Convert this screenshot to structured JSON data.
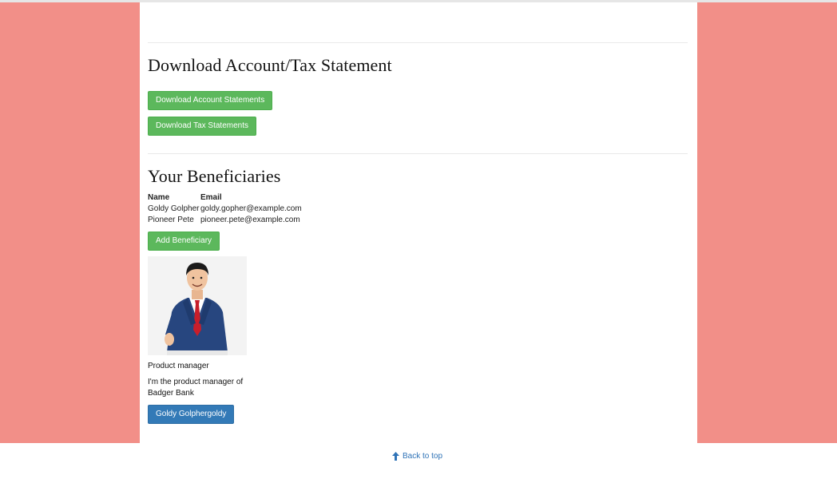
{
  "statements": {
    "heading": "Download Account/Tax Statement",
    "account_button": "Download Account Statements",
    "tax_button": "Download Tax Statements"
  },
  "beneficiaries": {
    "heading": "Your Beneficiaries",
    "columns": [
      "Name",
      "Email"
    ],
    "rows": [
      {
        "name": "Goldy Golpher",
        "email": "goldy.gopher@example.com"
      },
      {
        "name": "Pioneer Pete",
        "email": "pioneer.pete@example.com"
      }
    ],
    "add_button": "Add Beneficiary"
  },
  "profile": {
    "image_icon": "businessman-portrait",
    "title": "Product manager",
    "description": "I'm the product manager of Badger Bank",
    "button": "Goldy Golphergoldy"
  },
  "footer": {
    "back_to_top": "Back to top",
    "icon": "arrow-up-icon"
  },
  "colors": {
    "background_band": "#f28f88",
    "success_button": "#5cb85c",
    "primary_button": "#337ab7",
    "link": "#2f73b7"
  }
}
